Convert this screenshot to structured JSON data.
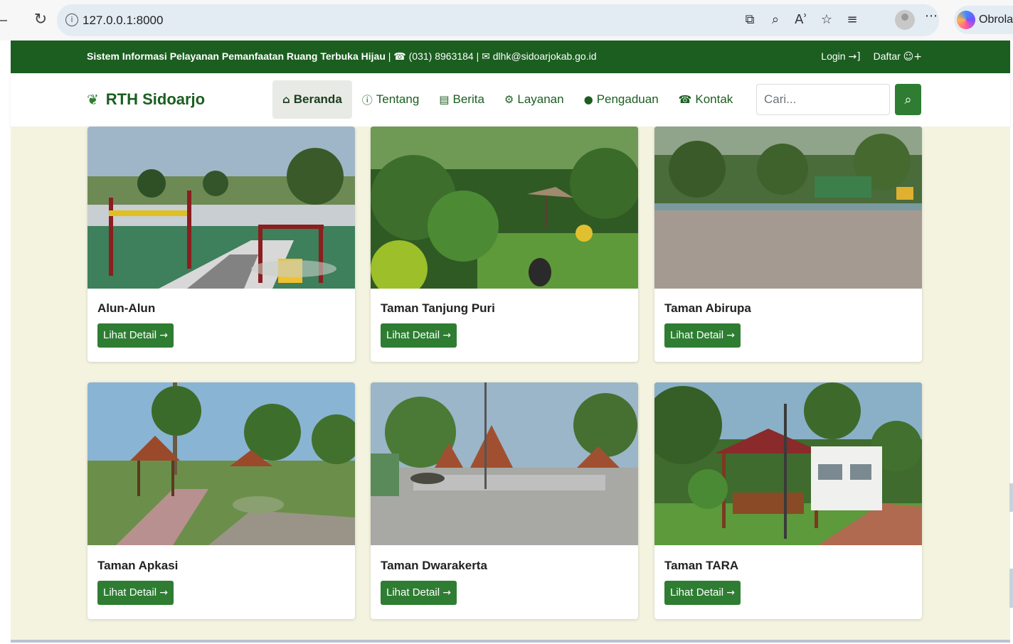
{
  "browser": {
    "reload_icon": "reload-icon",
    "url": "127.0.0.1:8000",
    "copilot_label": "Obrolan"
  },
  "topbar": {
    "site_name": "Sistem Informasi Pelayanan Pemanfaatan Ruang Terbuka Hijau",
    "phone": "(031) 8963184",
    "email": "dlhk@sidoarjokab.go.id",
    "login_label": "Login",
    "register_label": "Daftar"
  },
  "navbar": {
    "brand": "RTH Sidoarjo",
    "items": [
      {
        "label": "Beranda",
        "icon": "home-icon",
        "active": true
      },
      {
        "label": "Tentang",
        "icon": "info-icon"
      },
      {
        "label": "Berita",
        "icon": "newspaper-icon"
      },
      {
        "label": "Layanan",
        "icon": "gears-icon"
      },
      {
        "label": "Pengaduan",
        "icon": "comment-icon"
      },
      {
        "label": "Kontak",
        "icon": "phone-icon"
      }
    ],
    "search_placeholder": "Cari...",
    "search_icon": "search-icon"
  },
  "cards": [
    {
      "title": "Alun-Alun",
      "button": "Lihat Detail"
    },
    {
      "title": "Taman Tanjung Puri",
      "button": "Lihat Detail"
    },
    {
      "title": "Taman Abirupa",
      "button": "Lihat Detail"
    },
    {
      "title": "Taman Apkasi",
      "button": "Lihat Detail"
    },
    {
      "title": "Taman Dwarakerta",
      "button": "Lihat Detail"
    },
    {
      "title": "Taman TARA",
      "button": "Lihat Detail"
    }
  ],
  "colors": {
    "primary": "#2e7d32",
    "topbar": "#1b5e20",
    "background": "#f3f3df"
  }
}
